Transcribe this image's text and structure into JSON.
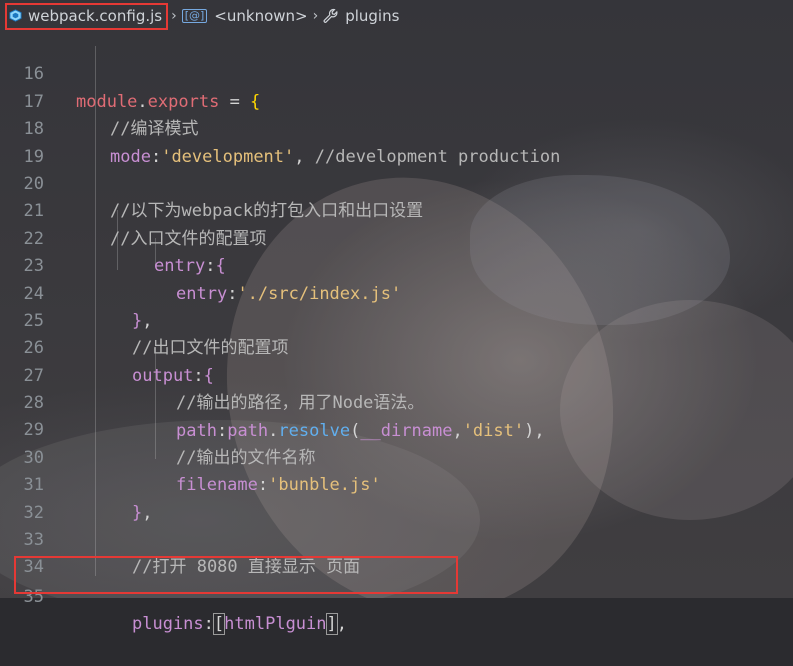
{
  "breadcrumb": {
    "file": "webpack.config.js",
    "symbol": "<unknown>",
    "section": "plugins"
  },
  "editor": {
    "lines": [
      {
        "n": "16"
      },
      {
        "n": "17"
      },
      {
        "n": "18"
      },
      {
        "n": "19"
      },
      {
        "n": "20"
      },
      {
        "n": "21"
      },
      {
        "n": "22"
      },
      {
        "n": "23"
      },
      {
        "n": "24"
      },
      {
        "n": "25"
      },
      {
        "n": "26"
      },
      {
        "n": "27"
      },
      {
        "n": "28"
      },
      {
        "n": "29"
      },
      {
        "n": "30"
      },
      {
        "n": "31"
      },
      {
        "n": "32"
      },
      {
        "n": "33"
      },
      {
        "n": "34"
      },
      {
        "n": "35"
      }
    ],
    "tokens": {
      "module": "module",
      "exports": "exports",
      "c17": "//编译模式",
      "mode": "mode",
      "mode_val": "'development'",
      "c18": "//development production",
      "c20": "//以下为webpack的打包入口和出口设置",
      "c21": "//入口文件的配置项",
      "entry_outer": "entry",
      "entry_inner": "entry",
      "entry_val": "'./src/index.js'",
      "c25": "//出口文件的配置项",
      "output": "output",
      "c27": "//输出的路径，用了Node语法。",
      "path": "path",
      "path_obj": "path",
      "resolve": "resolve",
      "dirname": "__dirname",
      "dist": "'dist'",
      "c29": "//输出的文件名称",
      "filename": "filename",
      "filename_val": "'bunble.js'",
      "c33": "//打开 8080 直接显示 页面",
      "plugins": "plugins",
      "plugin_item": "htmlPlguin"
    }
  },
  "colors": {
    "highlight_box": "#e53935",
    "keyword": "#e06c75",
    "property": "#c88fd3",
    "string": "#e5c07b",
    "function": "#61afef"
  }
}
